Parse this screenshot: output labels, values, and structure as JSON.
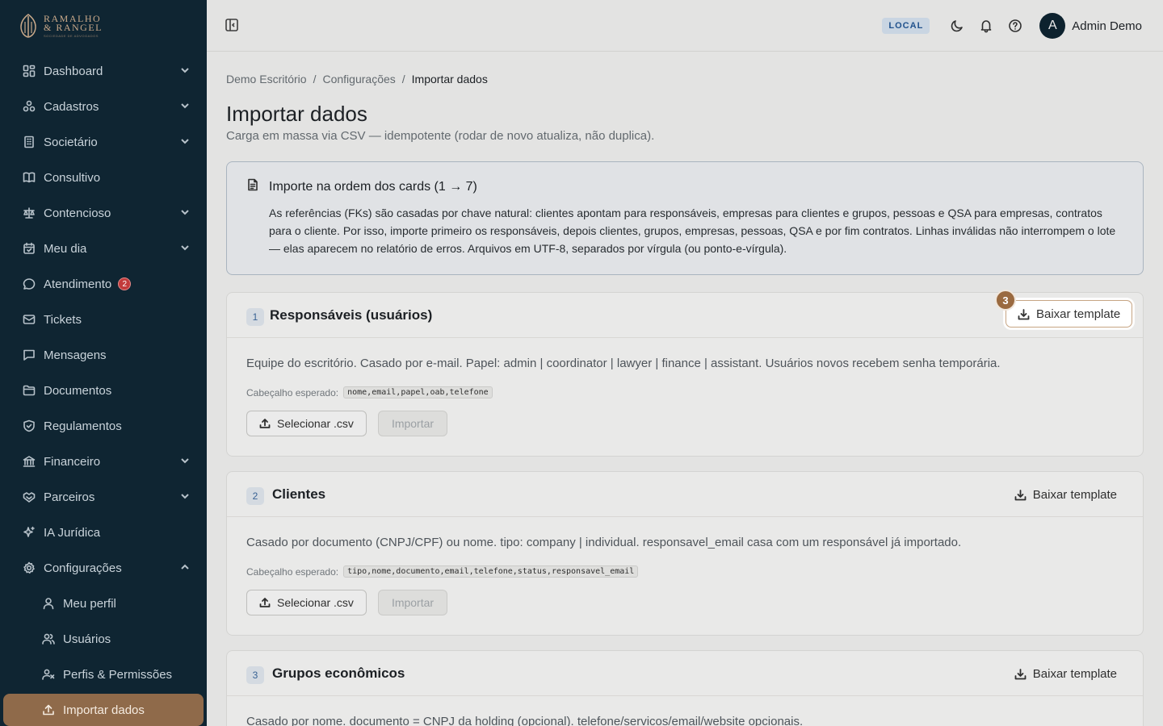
{
  "brand": {
    "line1": "RAMALHO",
    "line2": "& RANGEL",
    "tagline": "SOCIEDADE DE ADVOGADOS"
  },
  "sidebar": {
    "items": [
      {
        "label": "Dashboard",
        "icon": "dashboard-icon",
        "chevron": "down"
      },
      {
        "label": "Cadastros",
        "icon": "cadastros-icon",
        "chevron": "down"
      },
      {
        "label": "Societário",
        "icon": "building-icon",
        "chevron": "down"
      },
      {
        "label": "Consultivo",
        "icon": "book-icon",
        "chevron": null
      },
      {
        "label": "Contencioso",
        "icon": "scale-icon",
        "chevron": "down"
      },
      {
        "label": "Meu dia",
        "icon": "calendar-icon",
        "chevron": "down"
      },
      {
        "label": "Atendimento",
        "icon": "chat-icon",
        "chevron": null,
        "badge": "2"
      },
      {
        "label": "Tickets",
        "icon": "ticket-icon",
        "chevron": null
      },
      {
        "label": "Mensagens",
        "icon": "message-icon",
        "chevron": null
      },
      {
        "label": "Documentos",
        "icon": "folder-icon",
        "chevron": null
      },
      {
        "label": "Regulamentos",
        "icon": "shield-icon",
        "chevron": null
      },
      {
        "label": "Financeiro",
        "icon": "bank-icon",
        "chevron": "down"
      },
      {
        "label": "Parceiros",
        "icon": "handshake-icon",
        "chevron": "down"
      },
      {
        "label": "IA Jurídica",
        "icon": "sparkle-icon",
        "chevron": null
      },
      {
        "label": "Configurações",
        "icon": "gear-icon",
        "chevron": "up"
      }
    ],
    "subitems": [
      {
        "label": "Meu perfil",
        "icon": "user-icon"
      },
      {
        "label": "Usuários",
        "icon": "users-icon"
      },
      {
        "label": "Perfis & Permissões",
        "icon": "user-cog-icon"
      },
      {
        "label": "Importar dados",
        "icon": "upload-icon",
        "active": true
      }
    ]
  },
  "header": {
    "env": "LOCAL",
    "user": {
      "initial": "A",
      "name": "Admin Demo"
    }
  },
  "breadcrumb": [
    "Demo Escritório",
    "/",
    "Configurações",
    "/",
    "Importar dados"
  ],
  "page": {
    "title": "Importar dados",
    "subtitle": "Carga em massa via CSV — idempotente (rodar de novo atualiza, não duplica)."
  },
  "info": {
    "title": "Importe na ordem dos cards (1 → 7)",
    "body": "As referências (FKs) são casadas por chave natural: clientes apontam para responsáveis, empresas para clientes e grupos, pessoas e QSA para empresas, contratos para o cliente. Por isso, importe primeiro os responsáveis, depois clientes, grupos, empresas, pessoas, QSA e por fim contratos. Linhas inválidas não interrompem o lote — elas aparecem no relatório de erros. Arquivos em UTF-8, separados por vírgula (ou ponto-e-vírgula)."
  },
  "labels": {
    "template_button": "Baixar template",
    "header_label": "Cabeçalho esperado:",
    "select_csv": "Selecionar .csv",
    "import": "Importar"
  },
  "cards": [
    {
      "num": "1",
      "title": "Responsáveis (usuários)",
      "desc": "Equipe do escritório. Casado por e-mail. Papel: admin | coordinator | lawyer | finance | assistant. Usuários novos recebem senha temporária.",
      "header": "nome,email,papel,oab,telefone"
    },
    {
      "num": "2",
      "title": "Clientes",
      "desc": "Casado por documento (CNPJ/CPF) ou nome. tipo: company | individual. responsavel_email casa com um responsável já importado.",
      "header": "tipo,nome,documento,email,telefone,status,responsavel_email"
    },
    {
      "num": "3",
      "title": "Grupos econômicos",
      "desc": "Casado por nome. documento = CNPJ da holding (opcional). telefone/servicos/email/website opcionais."
    }
  ],
  "tour": {
    "step": "3"
  },
  "colors": {
    "sidebar_bg": "#0f2532",
    "accent": "#8f6a4a",
    "badge": "#c23b3b",
    "env_badge": "#dbe8f6"
  }
}
